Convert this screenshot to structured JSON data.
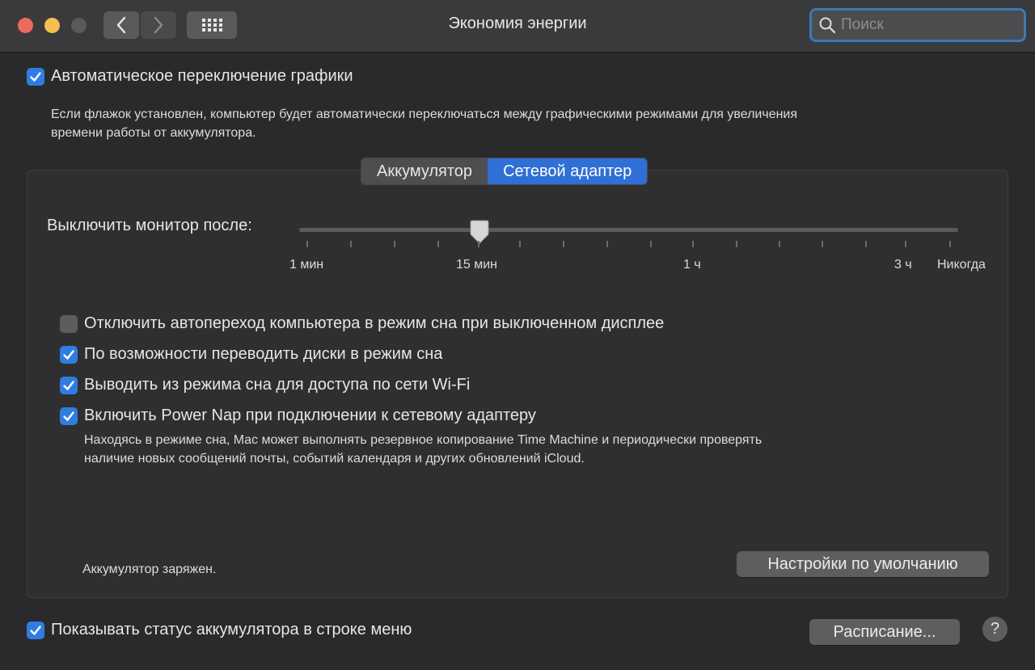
{
  "window": {
    "title": "Экономия энергии",
    "search_placeholder": "Поиск"
  },
  "auto_graphics": {
    "checked": true,
    "label": "Автоматическое переключение графики",
    "description_line1": "Если флажок установлен, компьютер будет автоматически переключаться между графическими режимами для увеличения",
    "description_line2": "времени работы от аккумулятора."
  },
  "tabs": [
    {
      "label": "Аккумулятор",
      "selected": false
    },
    {
      "label": "Сетевой адаптер",
      "selected": true
    }
  ],
  "display_sleep": {
    "label": "Выключить монитор после:",
    "tick_labels": [
      "1 мин",
      "15 мин",
      "1 ч",
      "3 ч",
      "Никогда"
    ],
    "value": "15 мин"
  },
  "options": [
    {
      "label": "Отключить автопереход компьютера в режим сна при выключенном дисплее",
      "checked": false
    },
    {
      "label": "По возможности переводить диски в режим сна",
      "checked": true
    },
    {
      "label": "Выводить из режима сна для доступа по сети Wi-Fi",
      "checked": true
    },
    {
      "label": "Включить Power Nap при подключении к сетевому адаптеру",
      "checked": true
    }
  ],
  "power_nap_note_line1": "Находясь в режиме сна, Mac может выполнять резервное копирование Time Machine и периодически проверять",
  "power_nap_note_line2": "наличие новых сообщений почты, событий календаря и других обновлений iCloud.",
  "battery_status": "Аккумулятор заряжен.",
  "defaults_button": "Настройки по умолчанию",
  "show_status": {
    "checked": true,
    "label": "Показывать статус аккумулятора в строке меню"
  },
  "schedule_button": "Расписание...",
  "help_label": "?",
  "colors": {
    "accent": "#2f7de1",
    "window_bg": "#2a2a2c"
  }
}
